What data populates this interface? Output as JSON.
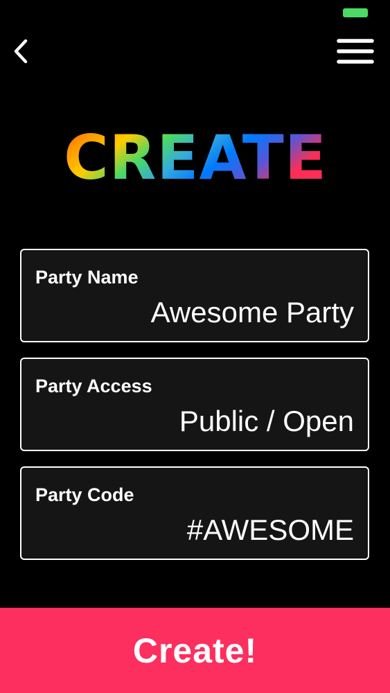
{
  "header": {
    "title": "CREATE",
    "back_icon": "chevron-left-icon",
    "menu_icon": "hamburger-menu-icon"
  },
  "status_bar": {
    "battery_color": "#4cd964"
  },
  "fields": [
    {
      "label": "Party Name",
      "value": "Awesome Party"
    },
    {
      "label": "Party Access",
      "value": "Public / Open"
    },
    {
      "label": "Party Code",
      "value": "#AWESOME"
    }
  ],
  "footer": {
    "create_label": "Create!",
    "button_color": "#fc2f5e"
  },
  "colors": {
    "background": "#000000",
    "field_background": "#151515",
    "field_border": "#ffffff",
    "title_gradient": [
      "#ff3b30",
      "#ff9500",
      "#ffcc00",
      "#4cd964",
      "#34aadc",
      "#007aff",
      "#5856d6",
      "#ff2d55"
    ]
  }
}
